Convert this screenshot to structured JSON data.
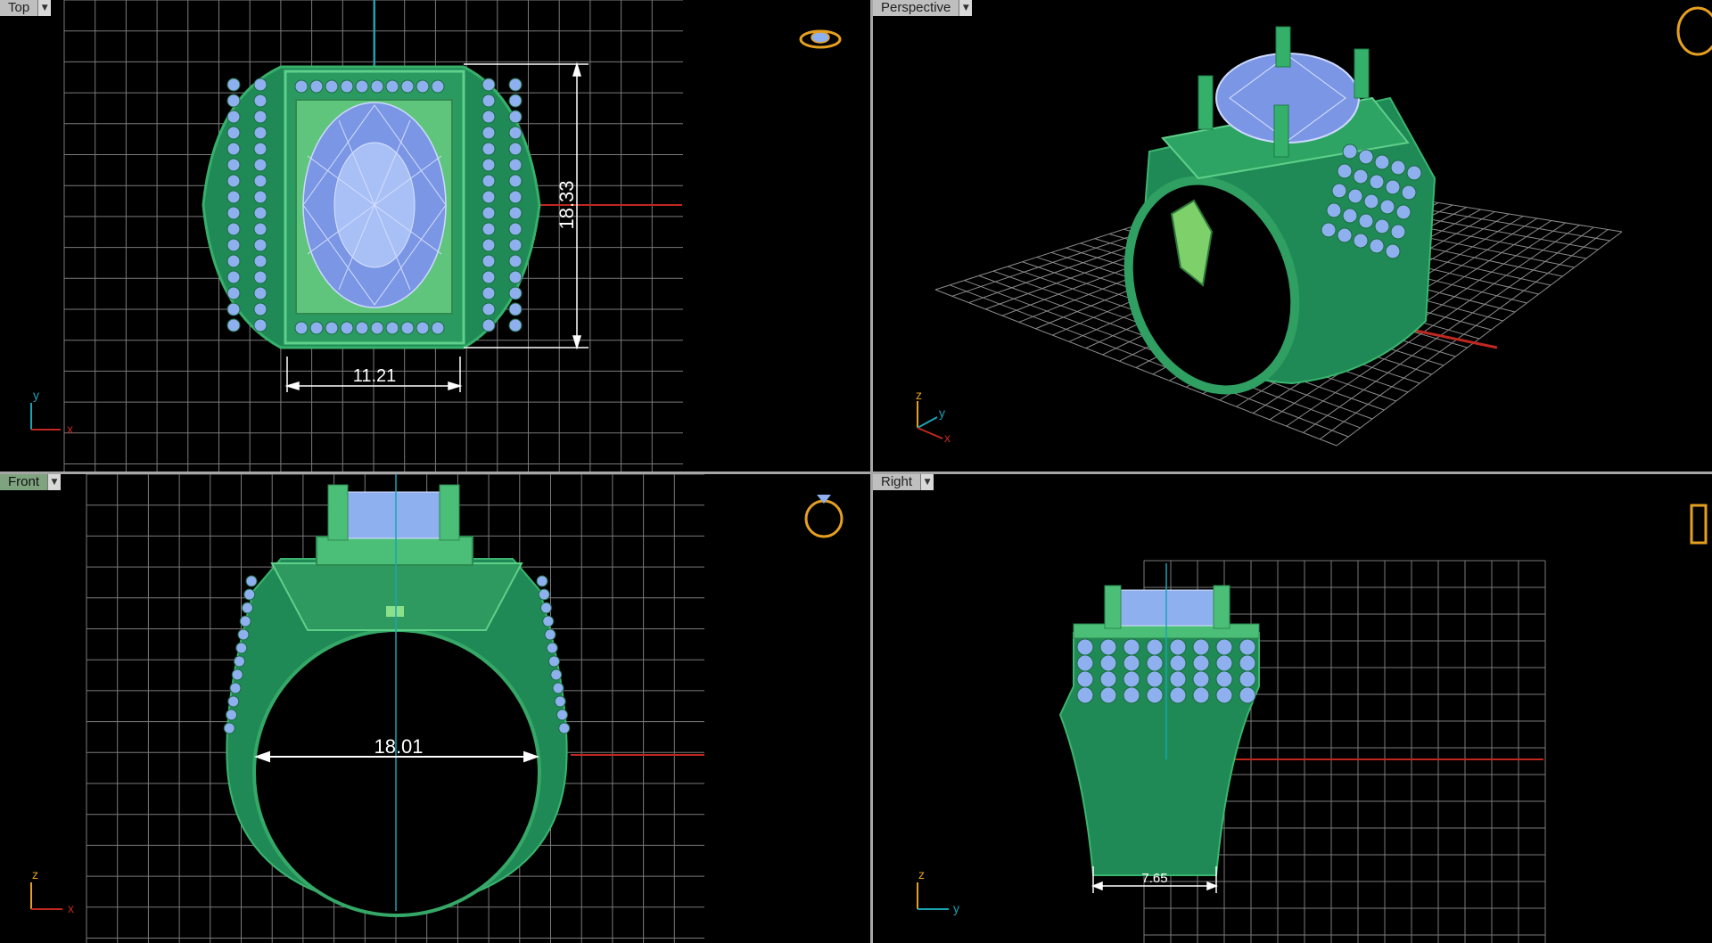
{
  "viewports": {
    "top": {
      "label": "Top",
      "dims": {
        "width": "11.21",
        "height": "18.33"
      },
      "axes": [
        "y",
        "x"
      ]
    },
    "perspective": {
      "label": "Perspective",
      "axes": [
        "z",
        "y",
        "x"
      ]
    },
    "front": {
      "label": "Front",
      "dims": {
        "inner": "18.01"
      },
      "axes": [
        "z",
        "x"
      ]
    },
    "right": {
      "label": "Right",
      "dims": {
        "shank": "7.65"
      },
      "axes": [
        "z",
        "y"
      ]
    }
  },
  "icons": {
    "dropdown": "chevron-down-icon",
    "ring": "ring-icon"
  },
  "colors": {
    "metal": "#1f8a55",
    "metal_light": "#4fc27c",
    "gem": "#8fb0ee",
    "grid": "#8a8a8a",
    "x_axis": "#c0281f",
    "y_axis": "#1aa3b5",
    "ui_tab": "#bfbfbf",
    "active_tab": "#7ea37e",
    "ring_icon": "#e6a020"
  }
}
